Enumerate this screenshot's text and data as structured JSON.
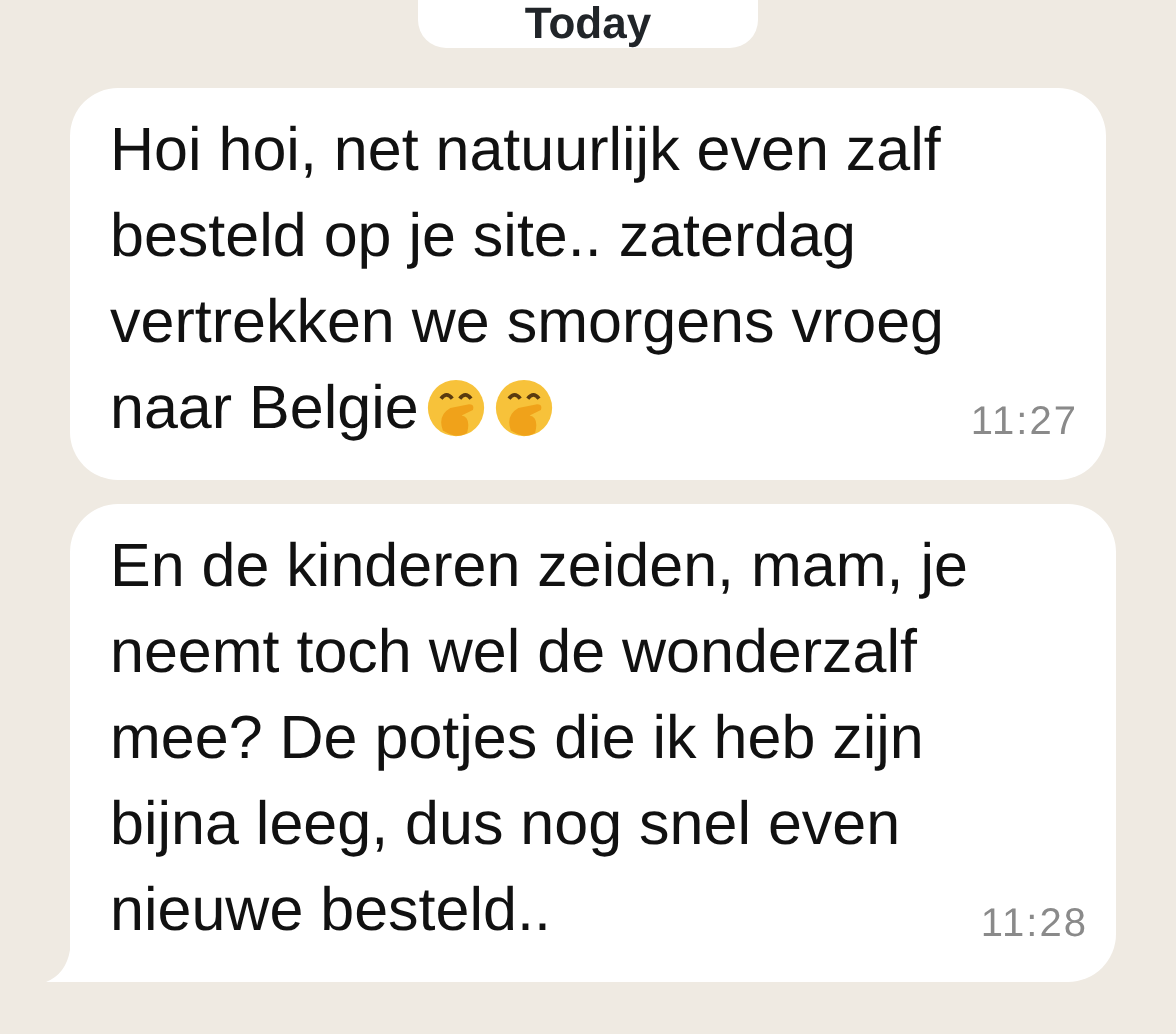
{
  "date_divider": "Today",
  "messages": [
    {
      "lines": [
        "Hoi hoi, net natuurlijk even zalf",
        "besteld op je site.. zaterdag",
        "vertrekken we smorgens vroeg",
        "naar Belgie"
      ],
      "emojis": [
        {
          "kind": "hand-over-mouth"
        },
        {
          "kind": "hand-over-mouth"
        }
      ],
      "time": "11:27",
      "tail": false
    },
    {
      "lines": [
        "En de kinderen zeiden, mam, je",
        "neemt toch wel de wonderzalf",
        "mee? De potjes die ik heb zijn",
        "bijna leeg, dus nog snel even",
        "nieuwe besteld.."
      ],
      "time": "11:28",
      "tail": true
    }
  ]
}
